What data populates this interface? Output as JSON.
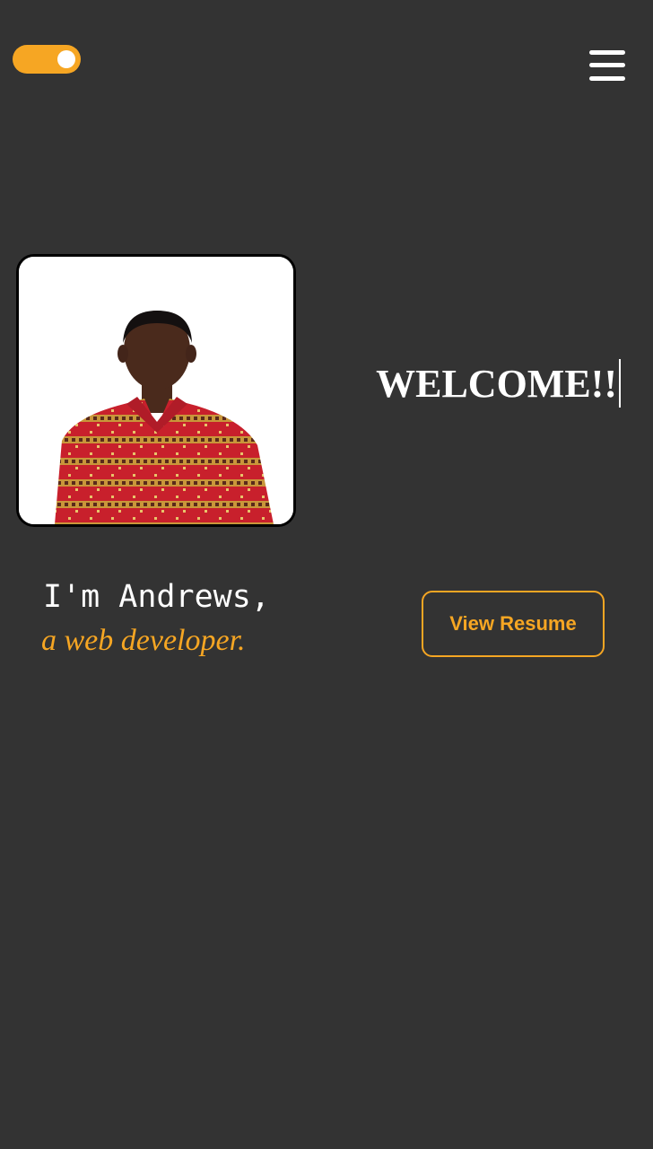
{
  "header": {
    "theme_toggle_icon": "toggle-switch-icon",
    "menu_icon": "hamburger-menu-icon"
  },
  "hero": {
    "photo_icon": "profile-photo",
    "welcome_text": "WELCOME!!",
    "intro_text": "I'm Andrews,",
    "role_text": "a web developer."
  },
  "actions": {
    "resume_label": "View Resume"
  },
  "colors": {
    "background": "#333333",
    "accent": "#f6a623",
    "text": "#ffffff",
    "photo_background": "#ffffff",
    "photo_border": "#000000"
  }
}
